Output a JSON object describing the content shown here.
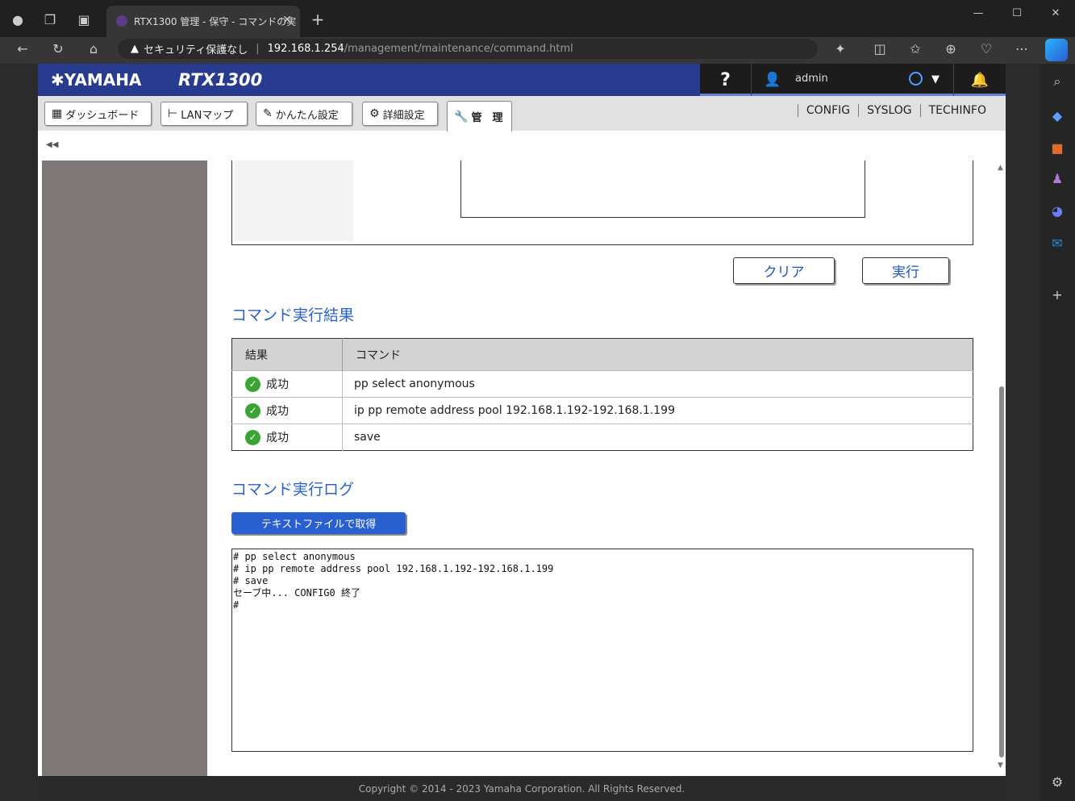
{
  "browser": {
    "tab_title": "RTX1300 管理 - 保守 - コマンドの実",
    "security_label": "セキュリティ保護なし",
    "url_host": "192.168.1.254",
    "url_path": "/management/maintenance/command.html"
  },
  "header": {
    "logo": "YAMAHA",
    "model": "RTX1300",
    "help": "?",
    "username": "admin"
  },
  "nav": {
    "tabs": [
      {
        "label": "ダッシュボード"
      },
      {
        "label": "LANマップ"
      },
      {
        "label": "かんたん設定"
      },
      {
        "label": "詳細設定"
      },
      {
        "label": "管　理"
      }
    ],
    "links": [
      "CONFIG",
      "SYSLOG",
      "TECHINFO"
    ]
  },
  "buttons": {
    "clear": "クリア",
    "execute": "実行",
    "download": "テキストファイルで取得"
  },
  "results": {
    "heading": "コマンド実行結果",
    "col_result": "結果",
    "col_command": "コマンド",
    "rows": [
      {
        "status": "成功",
        "command": "pp select anonymous"
      },
      {
        "status": "成功",
        "command": "ip pp remote address pool 192.168.1.192-192.168.1.199"
      },
      {
        "status": "成功",
        "command": "save"
      }
    ]
  },
  "log": {
    "heading": "コマンド実行ログ",
    "text": "# pp select anonymous\n# ip pp remote address pool 192.168.1.192-192.168.1.199\n# save\nセーブ中... CONFIG0 終了\n#"
  },
  "footer": {
    "copyright": "Copyright © 2014 - 2023 Yamaha Corporation. All Rights Reserved."
  }
}
